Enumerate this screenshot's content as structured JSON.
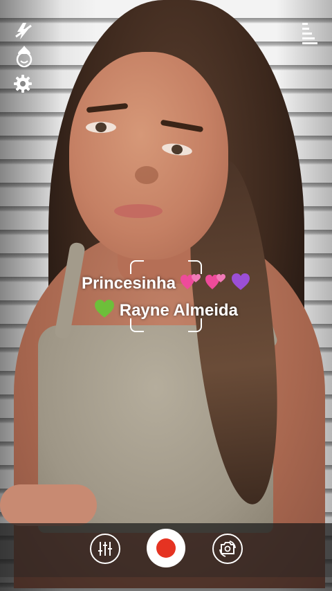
{
  "overlay": {
    "name_line1": "Princesinha",
    "name_line2": "Rayne Almeida"
  },
  "top_left_icons": [
    "flash-off-icon",
    "face-beauty-icon",
    "settings-gear-icon"
  ],
  "top_right_icons": [
    "menu-icon"
  ],
  "bottom_controls": [
    "filters-adjust-icon",
    "record-button",
    "switch-camera-icon"
  ],
  "colors": {
    "record_red": "#e53322",
    "bar_background": "#191919"
  }
}
